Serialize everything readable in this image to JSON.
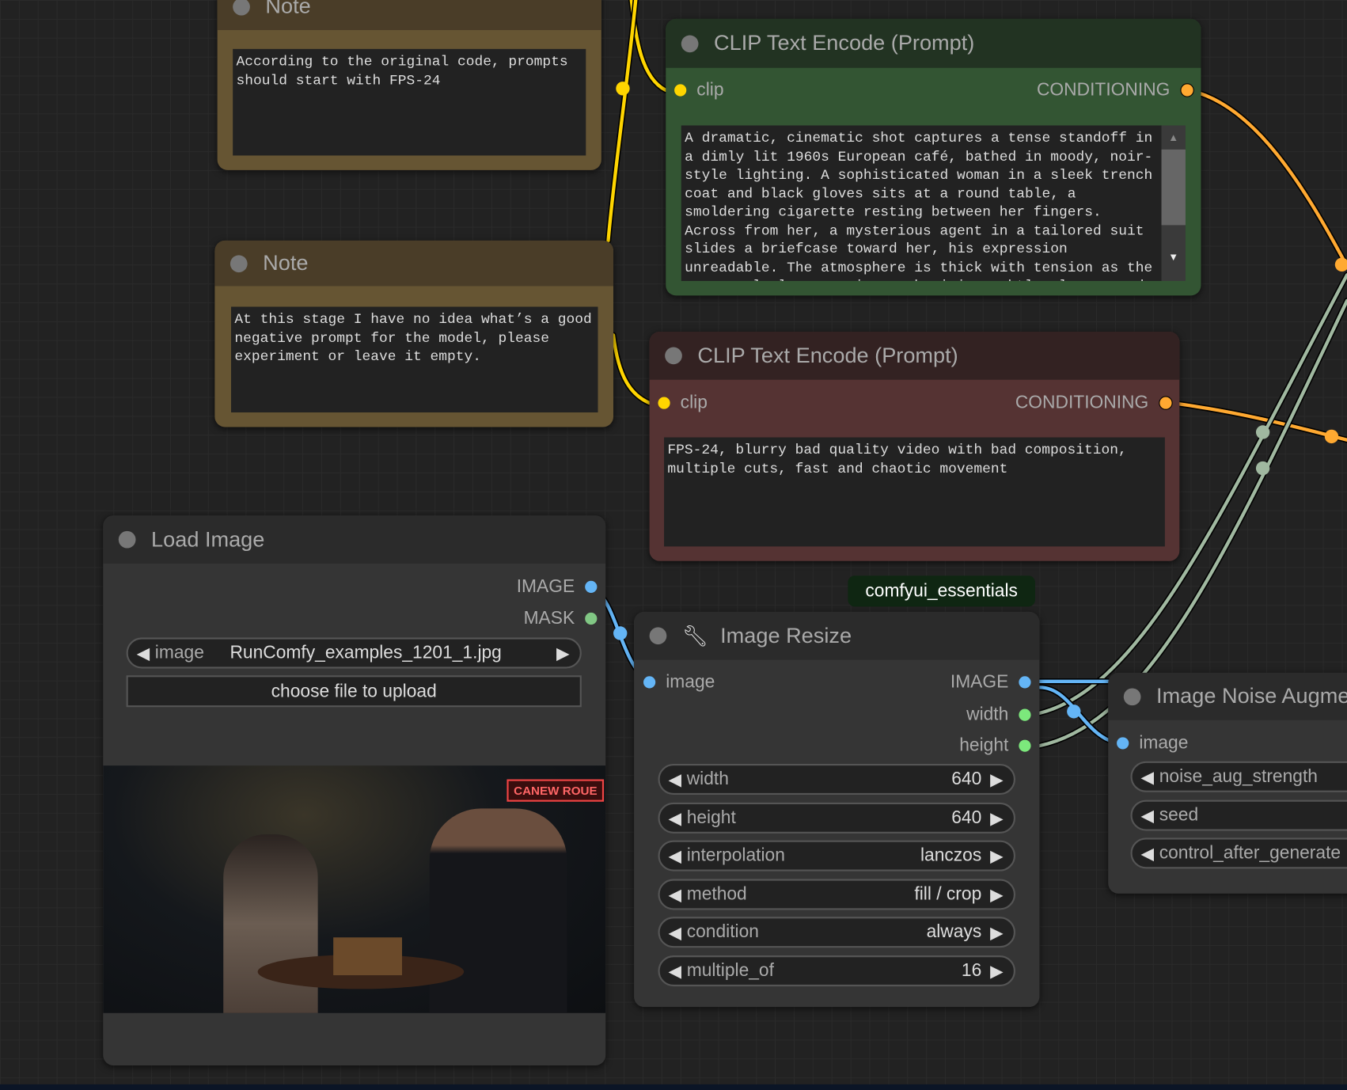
{
  "notes": [
    {
      "title": "Note",
      "text": "According to the original code, prompts should start with FPS-24"
    },
    {
      "title": "Note",
      "text": "At this stage I have no idea what’s a good negative prompt for the model, please experiment or leave it empty."
    }
  ],
  "clip_positive": {
    "title": "CLIP Text Encode (Prompt)",
    "input": "clip",
    "output": "CONDITIONING",
    "text": "A dramatic, cinematic shot captures a tense standoff in a dimly lit 1960s European café, bathed in moody, noir-style lighting. A sophisticated woman in a sleek trench coat and black gloves sits at a round table, a smoldering cigarette resting between her fingers. Across from her, a mysterious agent in a tailored suit slides a briefcase toward her, his expression unreadable. The atmosphere is thick with tension as the camera slowly zooms in, emphasizing subtle glances and the flickering glow of candlelight reflecting on the polished surfaces."
  },
  "clip_negative": {
    "title": "CLIP Text Encode (Prompt)",
    "input": "clip",
    "output": "CONDITIONING",
    "text": "FPS-24, blurry bad quality video with bad composition, multiple cuts, fast and chaotic movement"
  },
  "load_image": {
    "title": "Load Image",
    "outputs": [
      "IMAGE",
      "MASK"
    ],
    "combo_label": "image",
    "combo_value": "RunComfy_examples_1201_1.jpg",
    "upload_label": "choose file to upload",
    "sign_text": "CANEW ROUE"
  },
  "badge": "comfyui_essentials",
  "image_resize": {
    "title": "Image Resize",
    "input": "image",
    "outputs": [
      "IMAGE",
      "width",
      "height"
    ],
    "widgets": [
      {
        "label": "width",
        "value": "640"
      },
      {
        "label": "height",
        "value": "640"
      },
      {
        "label": "interpolation",
        "value": "lanczos"
      },
      {
        "label": "method",
        "value": "fill / crop"
      },
      {
        "label": "condition",
        "value": "always"
      },
      {
        "label": "multiple_of",
        "value": "16"
      }
    ]
  },
  "noise_aug": {
    "title": "Image Noise Augme",
    "input": "image",
    "widgets": [
      "noise_aug_strength",
      "seed",
      "control_after_generate"
    ]
  },
  "colors": {
    "clip": "#ffd500",
    "conditioning": "#ffa931",
    "image": "#64b5f6",
    "mask": "#81c784",
    "int": "#a0b8a0"
  }
}
